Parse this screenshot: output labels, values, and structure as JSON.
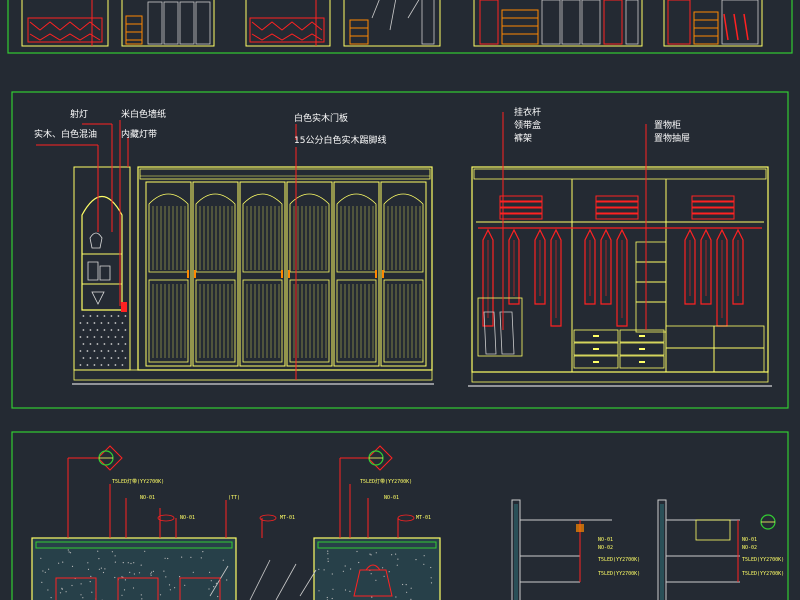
{
  "labels": {
    "spotlight": "射灯",
    "wall_paper": "米白色墙纸",
    "wood_mix": "实木、白色混油",
    "hidden_light": "内藏灯带",
    "door_panel": "白色实木门板",
    "baseboard": "15公分白色实木踢脚线",
    "tie_rack": "挂衣杆",
    "belt_box": "领带盒",
    "pants_rack": "裤架",
    "shelf_cab": "置物柜",
    "shelf_drawer": "置物抽屉"
  },
  "tags": {
    "led_a": "T5LED灯带(YY2700K)",
    "led_b": "T5LED灯带(YY2700K)",
    "t1": "NO-01",
    "t2": "NO-02",
    "t3": "NO-01",
    "t4": "(TT)",
    "t5": "MT-01",
    "t6": "NO-01",
    "t7": "MT-01",
    "r1": "NO-01",
    "r2": "NO-02",
    "r3": "T5LED(YY2700K)",
    "r4": "T5LED(YY2700K)",
    "r5": "NO-01",
    "r6": "NO-02",
    "r7": "T5LED(YY2700K)",
    "r8": "T5LED(YY2700K)"
  },
  "colors": {
    "background": "#242a33",
    "frame": "#33cc33",
    "cabinet": "#ffff66",
    "hanger": "#ff2222",
    "leader": "#ff2222",
    "text": "#ffffff",
    "glass": "#2e6b72"
  }
}
